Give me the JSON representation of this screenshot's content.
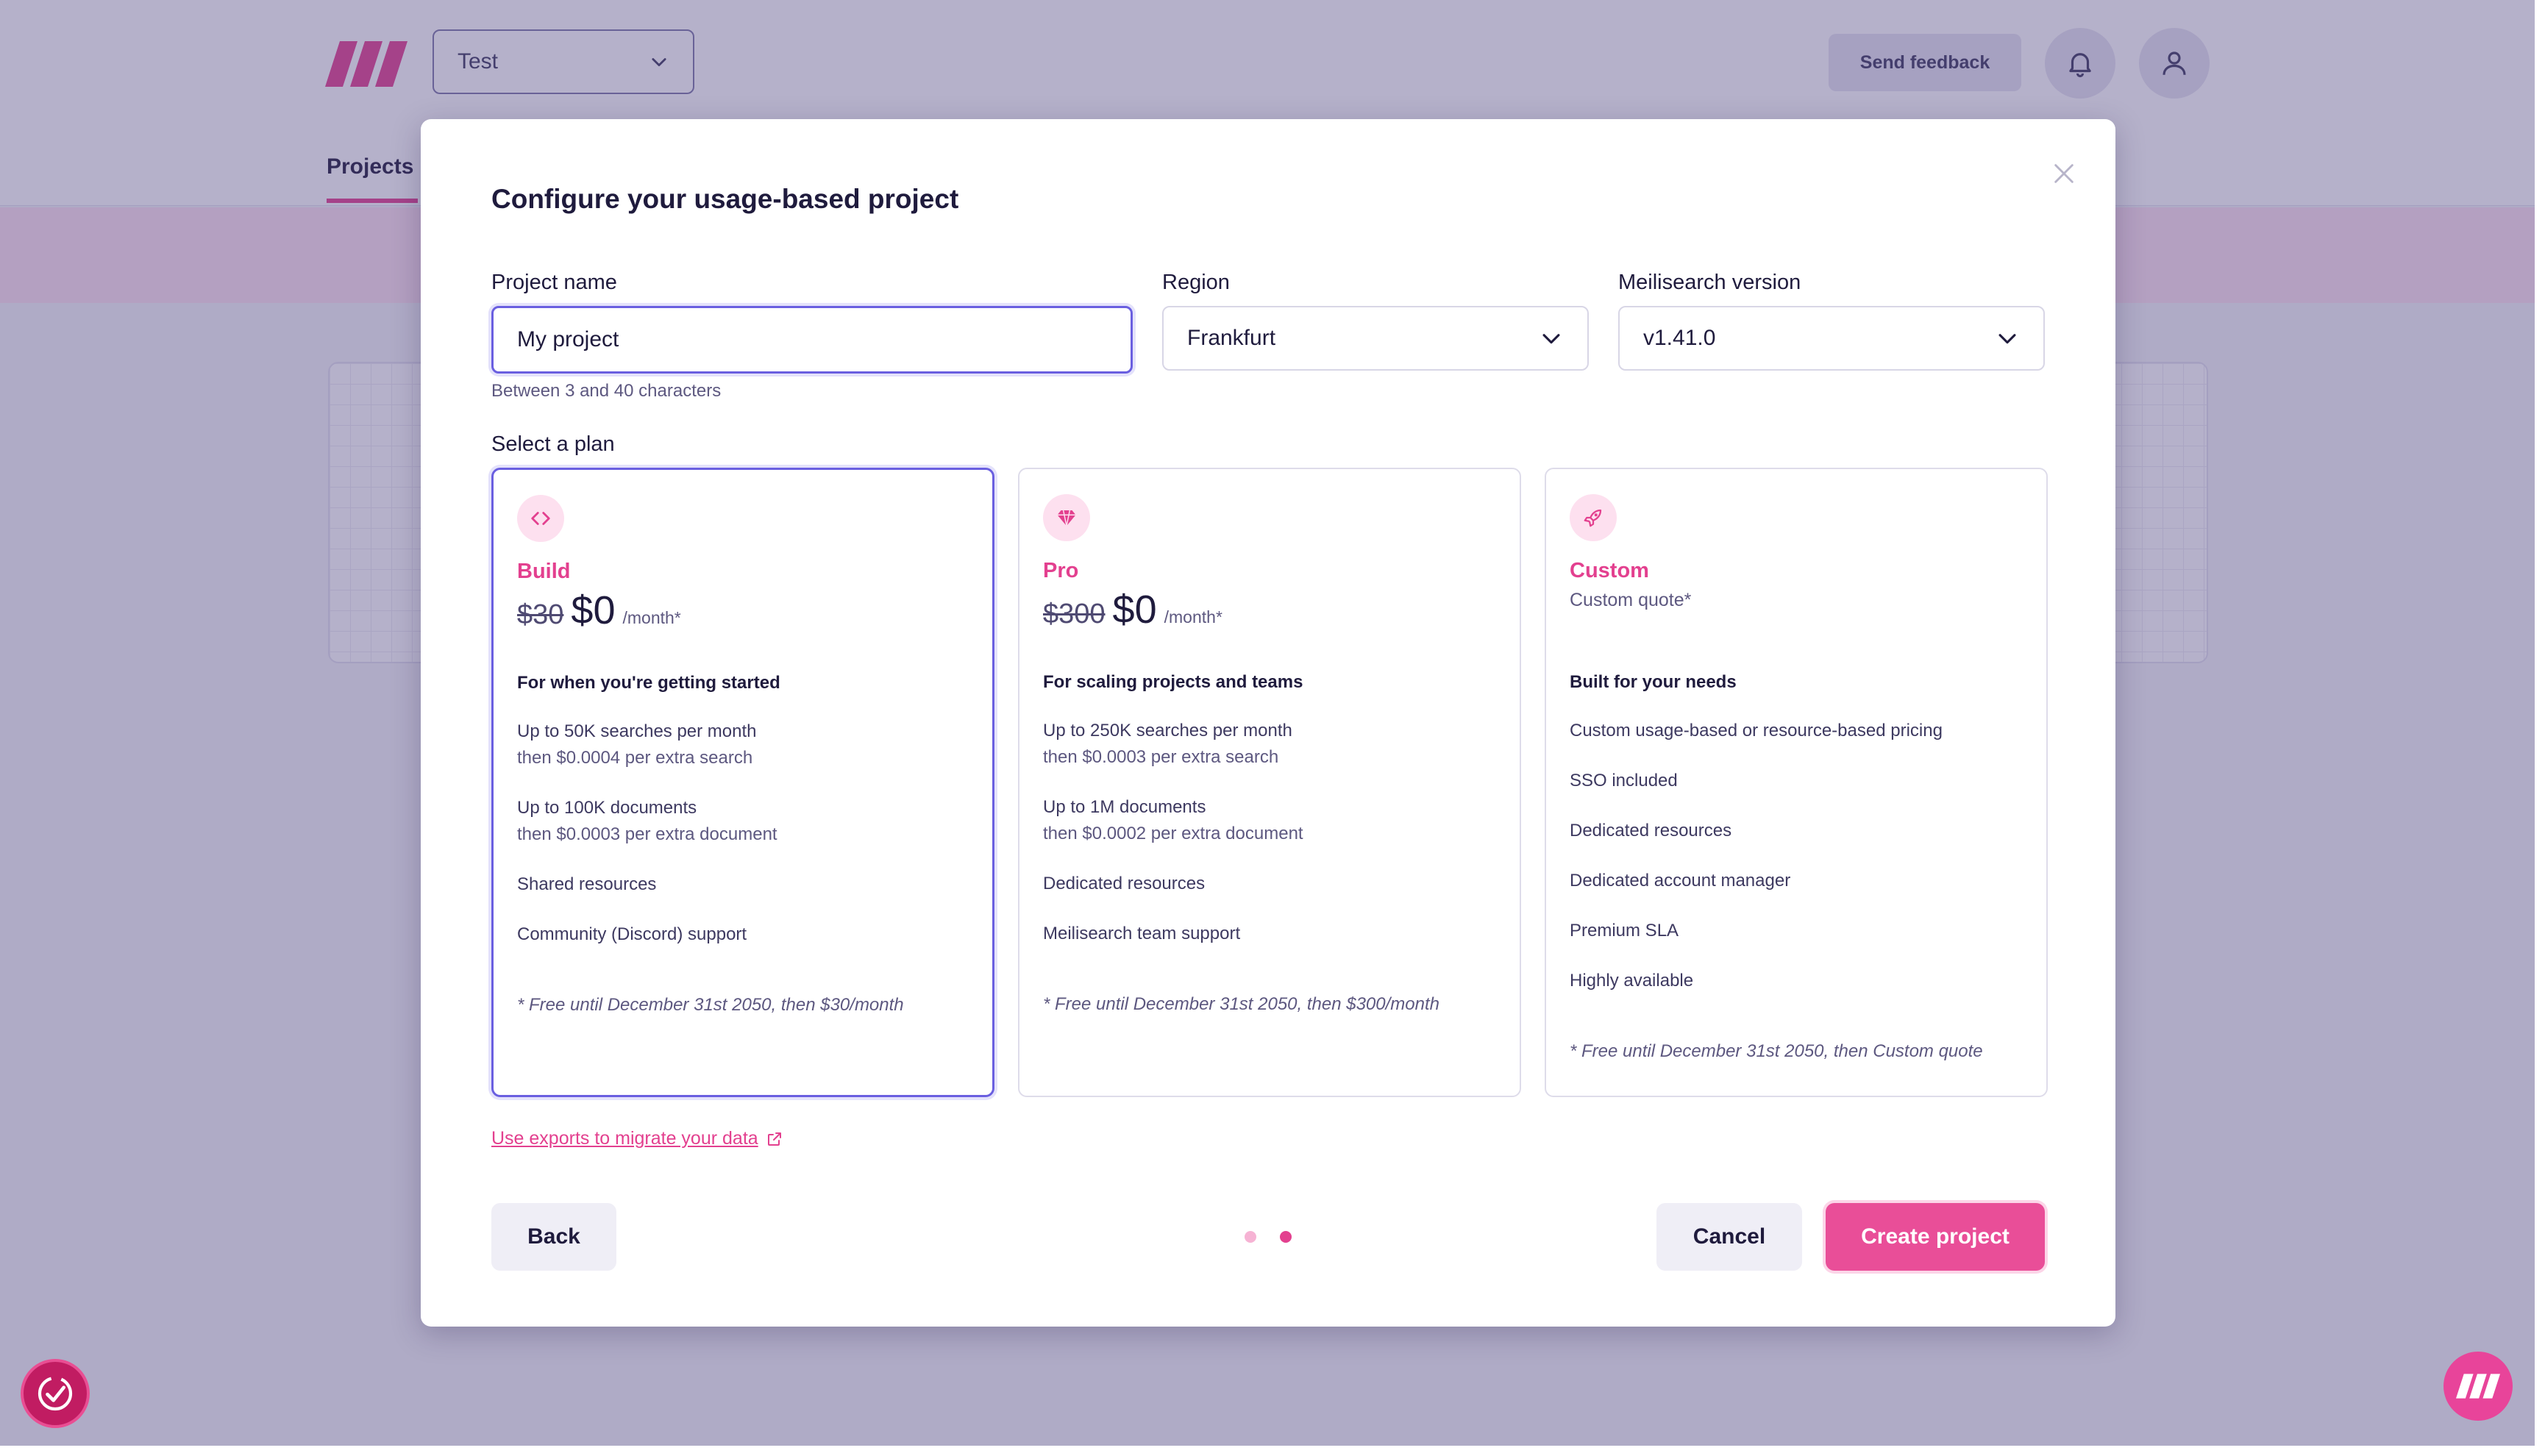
{
  "app": {
    "project_selector": "Test",
    "send_feedback": "Send feedback",
    "nav_tab": "Projects"
  },
  "modal": {
    "title": "Configure your usage-based project",
    "project_name": {
      "label": "Project name",
      "value": "My project",
      "hint": "Between 3 and 40 characters"
    },
    "region": {
      "label": "Region",
      "value": "Frankfurt"
    },
    "version": {
      "label": "Meilisearch version",
      "value": "v1.41.0"
    },
    "plan_label": "Select a plan",
    "plans": [
      {
        "name": "Build",
        "old_price": "$30",
        "price": "$0",
        "per": "/month*",
        "tagline": "For when you're getting started",
        "features": [
          {
            "main": "Up to 50K searches per month",
            "sub": "then $0.0004 per extra search"
          },
          {
            "main": "Up to 100K documents",
            "sub": "then $0.0003 per extra document"
          },
          {
            "main": "Shared resources"
          },
          {
            "main": "Community (Discord) support"
          }
        ],
        "footnote": "* Free until December 31st 2050, then $30/month",
        "selected": true
      },
      {
        "name": "Pro",
        "old_price": "$300",
        "price": "$0",
        "per": "/month*",
        "tagline": "For scaling projects and teams",
        "features": [
          {
            "main": "Up to 250K searches per month",
            "sub": "then $0.0003 per extra search"
          },
          {
            "main": "Up to 1M documents",
            "sub": "then $0.0002 per extra document"
          },
          {
            "main": "Dedicated resources"
          },
          {
            "main": "Meilisearch team support"
          }
        ],
        "footnote": "* Free until December 31st 2050, then $300/month",
        "selected": false
      },
      {
        "name": "Custom",
        "quote": "Custom quote*",
        "tagline": "Built for your needs",
        "features": [
          {
            "main": "Custom usage-based or resource-based pricing"
          },
          {
            "main": "SSO included"
          },
          {
            "main": "Dedicated resources"
          },
          {
            "main": "Dedicated account manager"
          },
          {
            "main": "Premium SLA"
          },
          {
            "main": "Highly available"
          }
        ],
        "footnote": "* Free until December 31st 2050, then Custom quote",
        "selected": false
      }
    ],
    "migrate_link": "Use exports to migrate your data",
    "back": "Back",
    "cancel": "Cancel",
    "create": "Create project",
    "step": {
      "current": 2,
      "total": 2
    }
  },
  "colors": {
    "accent": "#e3408f",
    "focus": "#6a5fe0",
    "primary_button": "#e94e98"
  },
  "icons": [
    "logo-icon",
    "chevron-down-icon",
    "bell-icon",
    "user-icon",
    "close-icon",
    "code-icon",
    "diamond-icon",
    "rocket-icon",
    "external-link-icon",
    "speed-check-icon"
  ]
}
